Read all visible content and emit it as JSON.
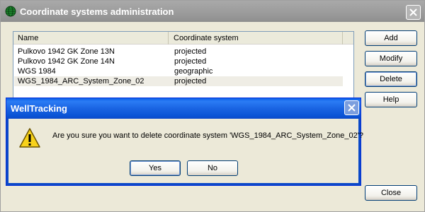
{
  "window": {
    "title": "Coordinate systems administration",
    "icon": "globe-icon"
  },
  "list": {
    "columns": [
      "Name",
      "Coordinate system"
    ],
    "rows": [
      {
        "name": "Pulkovo 1942 GK Zone 13N",
        "system": "projected"
      },
      {
        "name": "Pulkovo 1942 GK Zone 14N",
        "system": "projected"
      },
      {
        "name": "WGS 1984",
        "system": "geographic"
      },
      {
        "name": "WGS_1984_ARC_System_Zone_02",
        "system": "projected",
        "selected": true
      }
    ]
  },
  "buttons": {
    "add": "Add",
    "modify": "Modify",
    "delete": "Delete",
    "help": "Help",
    "close": "Close"
  },
  "dialog": {
    "title": "WellTracking",
    "message": "Are you sure you want to delete coordinate system 'WGS_1984_ARC_System_Zone_02'?",
    "icon": "warning-icon",
    "yes": "Yes",
    "no": "No"
  },
  "colors": {
    "dialog_title": "#0a54d6",
    "inactive_title": "#9b9b9b"
  }
}
